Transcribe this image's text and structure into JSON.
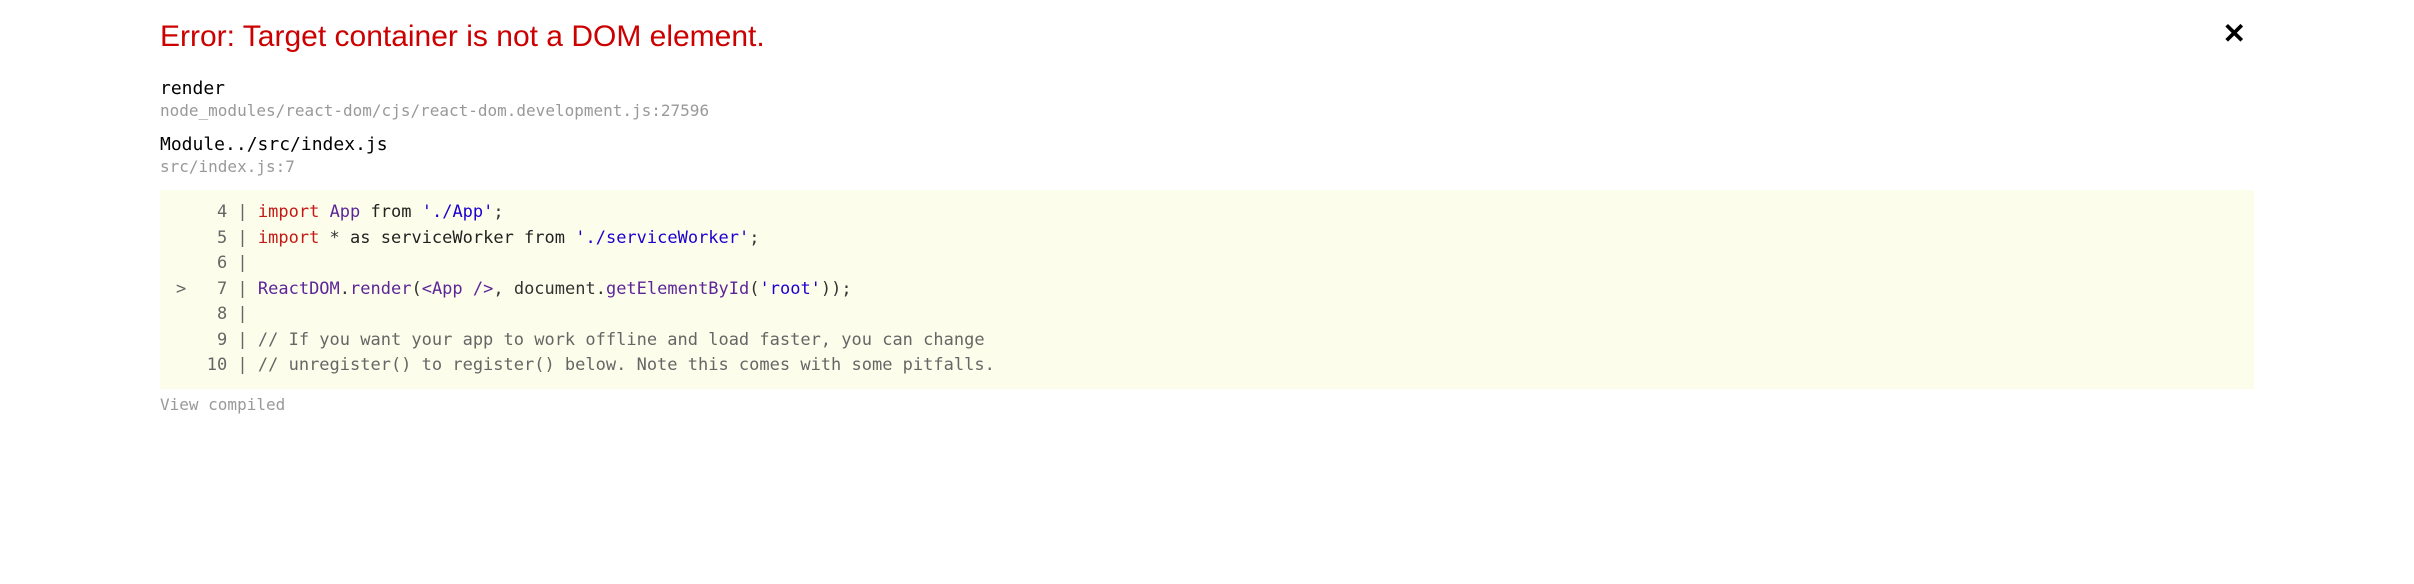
{
  "error": {
    "title": "Error: Target container is not a DOM element."
  },
  "frames": [
    {
      "function": "render",
      "location": "node_modules/react-dom/cjs/react-dom.development.js:27596"
    },
    {
      "function": "Module../src/index.js",
      "location": "src/index.js:7"
    }
  ],
  "code": {
    "lines": [
      {
        "marker": " ",
        "num": "4",
        "tokens": [
          {
            "t": "import",
            "c": "tk-keyword"
          },
          {
            "t": " ",
            "c": ""
          },
          {
            "t": "App",
            "c": "tk-ident"
          },
          {
            "t": " ",
            "c": ""
          },
          {
            "t": "from",
            "c": "tk-from"
          },
          {
            "t": " ",
            "c": ""
          },
          {
            "t": "'./App'",
            "c": "tk-string"
          },
          {
            "t": ";",
            "c": "tk-punct"
          }
        ]
      },
      {
        "marker": " ",
        "num": "5",
        "tokens": [
          {
            "t": "import",
            "c": "tk-keyword"
          },
          {
            "t": " * ",
            "c": "tk-punct"
          },
          {
            "t": "as",
            "c": "tk-from"
          },
          {
            "t": " serviceWorker ",
            "c": "tk-from"
          },
          {
            "t": "from",
            "c": "tk-from"
          },
          {
            "t": " ",
            "c": ""
          },
          {
            "t": "'./serviceWorker'",
            "c": "tk-string"
          },
          {
            "t": ";",
            "c": "tk-punct"
          }
        ]
      },
      {
        "marker": " ",
        "num": "6",
        "tokens": []
      },
      {
        "marker": ">",
        "num": "7",
        "tokens": [
          {
            "t": "ReactDOM",
            "c": "tk-ident"
          },
          {
            "t": ".",
            "c": "tk-punct"
          },
          {
            "t": "render",
            "c": "tk-fn"
          },
          {
            "t": "(",
            "c": "tk-punct"
          },
          {
            "t": "<App />",
            "c": "tk-tag"
          },
          {
            "t": ", document.",
            "c": "tk-punct"
          },
          {
            "t": "getElementById",
            "c": "tk-fn"
          },
          {
            "t": "(",
            "c": "tk-punct"
          },
          {
            "t": "'root'",
            "c": "tk-string"
          },
          {
            "t": "));",
            "c": "tk-punct"
          }
        ]
      },
      {
        "marker": " ",
        "num": "8",
        "tokens": []
      },
      {
        "marker": " ",
        "num": "9",
        "tokens": [
          {
            "t": "// If you want your app to work offline and load faster, you can change",
            "c": "tk-comment"
          }
        ]
      },
      {
        "marker": " ",
        "num": "10",
        "tokens": [
          {
            "t": "// unregister() to register() below. Note this comes with some pitfalls.",
            "c": "tk-comment"
          }
        ]
      }
    ]
  },
  "footer": {
    "view_compiled": "View compiled"
  }
}
